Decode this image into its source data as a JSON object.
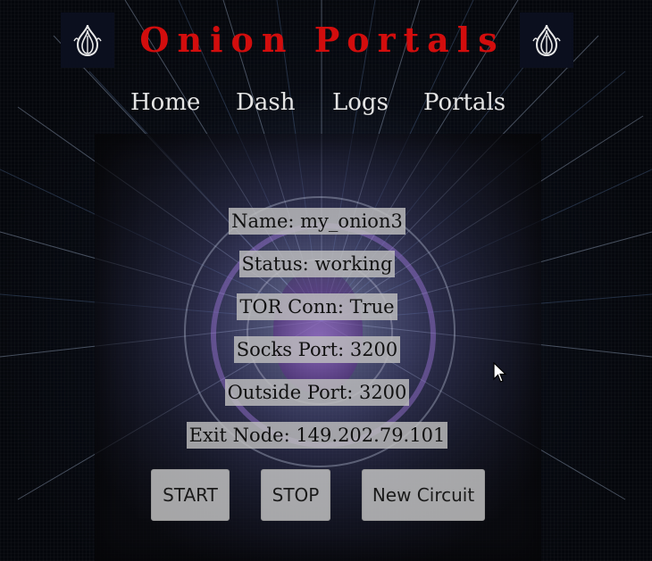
{
  "header": {
    "title": "Onion Portals",
    "logo_icon": "onion-logo-icon",
    "title_color": "#d20d0d"
  },
  "nav": {
    "items": [
      {
        "label": "Home"
      },
      {
        "label": "Dash"
      },
      {
        "label": "Logs"
      },
      {
        "label": "Portals"
      }
    ]
  },
  "portal": {
    "name": "Name: my_onion3",
    "status": "Status: working",
    "tor_conn": "TOR Conn: True",
    "socks_port": "Socks Port: 3200",
    "outside_port": "Outside Port: 3200",
    "exit_node": "Exit Node: 149.202.79.101"
  },
  "actions": {
    "start_label": "START",
    "stop_label": "STOP",
    "new_circuit_label": "New Circuit"
  }
}
